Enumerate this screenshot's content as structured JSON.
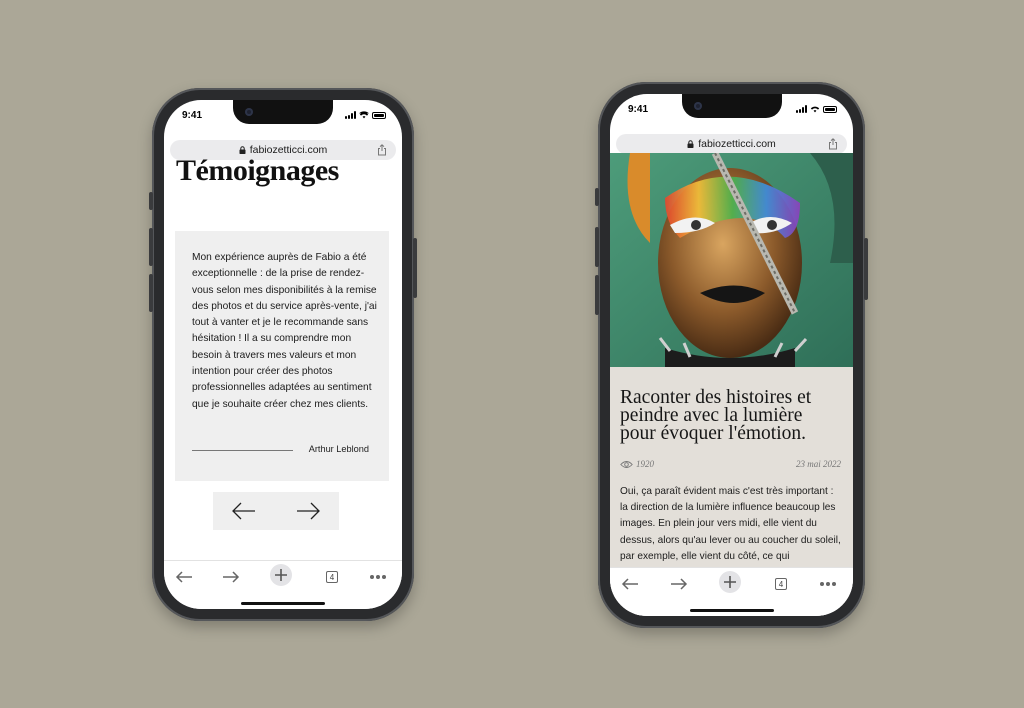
{
  "status": {
    "time": "9:41"
  },
  "browser": {
    "url": "fabiozetticci.com",
    "open_tabs_count": "4"
  },
  "left_page": {
    "heading": "Témoignages",
    "testimonial": {
      "quote": "Mon expérience auprès de Fabio a été exceptionnelle : de la prise de rendez-vous selon mes disponibilités à la remise des photos et du service après-vente, j'ai tout à vanter et je le recommande sans hésitation ! Il a su comprendre mon besoin à travers mes valeurs et mon intention pour créer des photos professionnelles adaptées au sentiment que je souhaite créer chez mes clients.",
      "author": "Arthur Leblond"
    },
    "carousel": {
      "prev_icon": "arrow-left-icon",
      "next_icon": "arrow-right-icon"
    }
  },
  "right_page": {
    "article": {
      "title": "Raconter des histoires et peindre avec la lumière pour évoquer l'émotion.",
      "views": "1920",
      "date": "23 mai 2022",
      "body": "Oui, ça paraît évident mais c'est très important : la direction de la lumière influence beaucoup les images. En plein jour vers midi, elle vient du dessus, alors qu'au lever ou au coucher du soleil, par exemple, elle vient du côté, ce qui"
    }
  },
  "colors": {
    "background": "#aba797",
    "phone_frame": "#2a2b2d",
    "card_gray": "#efefef",
    "article_beige": "#e3dfd9"
  },
  "icons": [
    "lock-icon",
    "share-icon",
    "back-icon",
    "forward-icon",
    "new-tab-icon",
    "tabs-icon",
    "more-icon",
    "eye-icon"
  ]
}
